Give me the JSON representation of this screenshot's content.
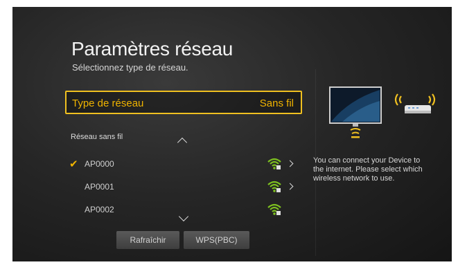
{
  "header": {
    "title": "Paramètres réseau",
    "subtitle": "Sélectionnez type de réseau."
  },
  "network_type": {
    "label": "Type de réseau",
    "value": "Sans fil"
  },
  "wireless": {
    "section_label": "Réseau sans fil",
    "networks": [
      {
        "name": "AP0000",
        "selected": true,
        "has_arrow": true,
        "signal_icon": "wifi-signal-icon"
      },
      {
        "name": "AP0001",
        "selected": false,
        "has_arrow": true,
        "signal_icon": "wifi-signal-icon"
      },
      {
        "name": "AP0002",
        "selected": false,
        "has_arrow": false,
        "signal_icon": "wifi-signal-icon"
      }
    ]
  },
  "buttons": {
    "refresh": "Rafraîchir",
    "wps": "WPS(PBC)"
  },
  "info": {
    "text": "You can connect your Device to the internet. Please select which wireless network to use."
  },
  "colors": {
    "accent": "#f0b400",
    "signal": "#7dc020"
  }
}
